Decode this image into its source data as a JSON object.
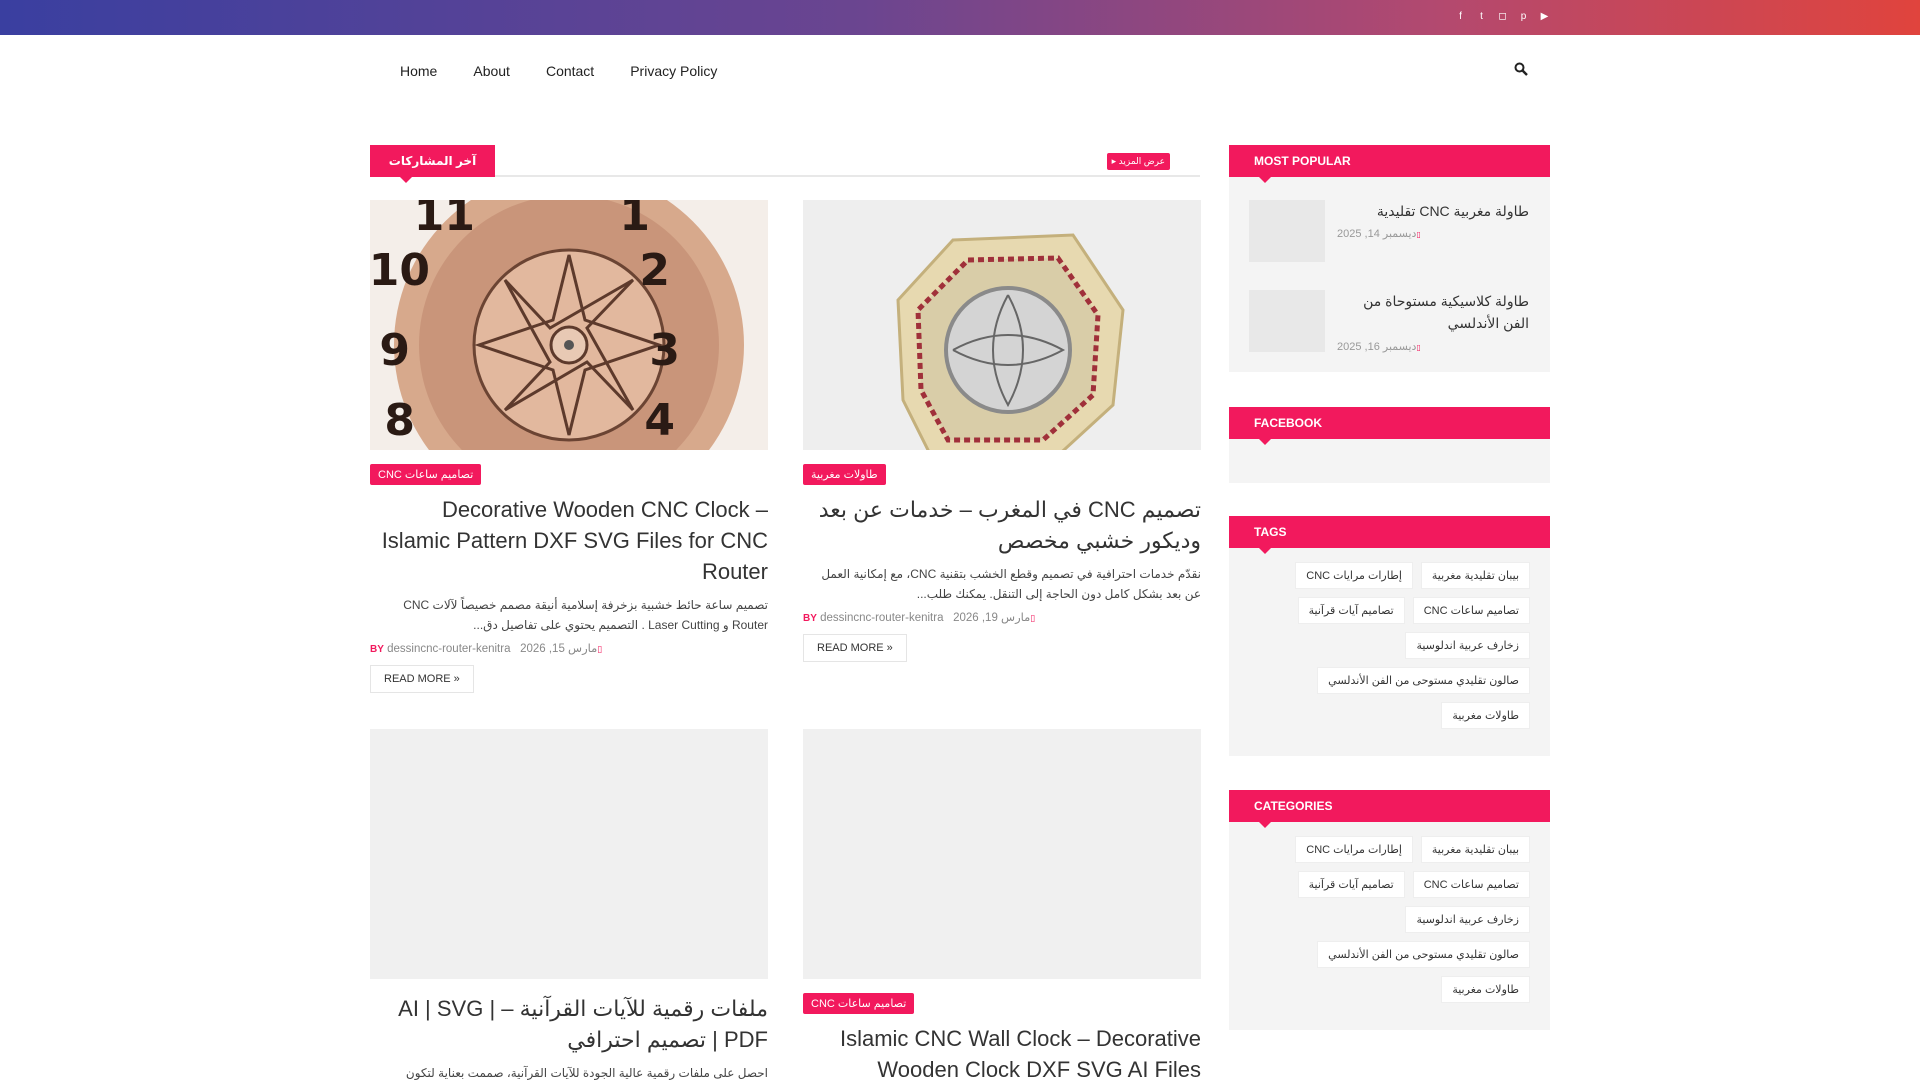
{
  "social": [
    "facebook-icon",
    "twitter-icon",
    "instagram-icon",
    "pinterest-icon",
    "youtube-icon"
  ],
  "nav": {
    "items": [
      "Home",
      "About",
      "Contact",
      "Privacy Policy"
    ]
  },
  "main": {
    "section_title": "آخر المشاركات",
    "more_label": "عرض المزيد",
    "posts": [
      {
        "label": "تصاميم ساعات CNC",
        "title": "Decorative Wooden CNC Clock – Islamic Pattern DXF SVG Files for CNC Router",
        "excerpt": "تصميم ساعة حائط خشبية بزخرفة إسلامية أنيقة مصمم خصيصاً لآلات CNC Router و Laser Cutting . التصميم يحتوي على تفاصيل دق...",
        "by": "BY",
        "author": "dessincnc-router-kenitra",
        "date": "مارس 15, 2026",
        "readmore": "READ MORE »"
      },
      {
        "label": "طاولات مغربية",
        "title": "تصميم CNC في المغرب – خدمات عن بعد وديكور خشبي مخصص",
        "excerpt": "نقدّم خدمات احترافية في تصميم وقطع الخشب بتقنية CNC، مع إمكانية العمل عن بعد بشكل كامل دون الحاجة إلى التنقل. يمكنك طلب...",
        "by": "BY",
        "author": "dessincnc-router-kenitra",
        "date": "مارس 19, 2026",
        "readmore": "READ MORE »"
      },
      {
        "label": "",
        "title": "ملفات رقمية للآيات القرآنية – AI | SVG | PDF | تصميم احترافي",
        "excerpt": "احصل على ملفات رقمية عالية الجودة للآيات القرآنية، صممت بعناية لتكون",
        "by": "",
        "author": "",
        "date": "",
        "readmore": ""
      },
      {
        "label": "تصاميم ساعات CNC",
        "title": "Islamic CNC Wall Clock – Decorative Wooden Clock DXF SVG AI Files",
        "excerpt": "",
        "by": "",
        "author": "",
        "date": "",
        "readmore": ""
      }
    ]
  },
  "sidebar": {
    "popular": {
      "title": "MOST POPULAR",
      "items": [
        {
          "title": "طاولة مغربية CNC تقليدية",
          "date": "ديسمبر 14, 2025"
        },
        {
          "title": "طاولة كلاسيكية مستوحاة من الفن الأندلسي",
          "date": "ديسمبر 16, 2025"
        }
      ]
    },
    "facebook": {
      "title": "FACEBOOK"
    },
    "tags": {
      "title": "TAGS",
      "items": [
        "بيبان تقليدية مغربية",
        "إطارات مرايات CNC",
        "تصاميم ساعات CNC",
        "تصاميم آيات قرآنية",
        "زخارف عربية اندلوسية",
        "صالون تقليدي مستوحى من الفن الأندلسي",
        "طاولات مغربية"
      ]
    },
    "categories": {
      "title": "CATEGORIES",
      "items": [
        "بيبان تقليدية مغربية",
        "إطارات مرايات CNC",
        "تصاميم ساعات CNC",
        "تصاميم آيات قرآنية",
        "زخارف عربية اندلوسية",
        "صالون تقليدي مستوحى من الفن الأندلسي",
        "طاولات مغربية"
      ]
    }
  }
}
